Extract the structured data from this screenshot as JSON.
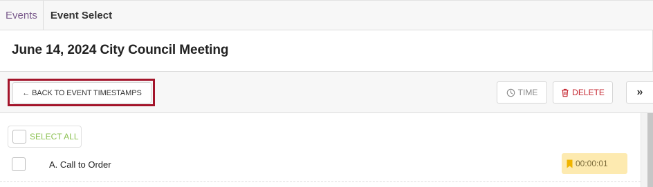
{
  "breadcrumb": {
    "parent": "Events",
    "current": "Event Select"
  },
  "page": {
    "title": "June 14, 2024 City Council Meeting"
  },
  "toolbar": {
    "back_label": "← BACK TO EVENT TIMESTAMPS",
    "time_label": "TIME",
    "time_icon": "clock-icon",
    "delete_label": "DELETE",
    "delete_icon": "trash-icon",
    "more_label": "»"
  },
  "list": {
    "select_all_label": "SELECT ALL",
    "items": [
      {
        "label": "A. Call to Order",
        "timestamp": "00:00:01",
        "icon": "bookmark-icon"
      }
    ]
  },
  "colors": {
    "breadcrumb_link": "#7a5a8c",
    "highlight_border": "#a3142a",
    "delete": "#c4232d",
    "select_all": "#8cc152",
    "timestamp_bg": "#fdeab0",
    "bookmark": "#f0b400"
  }
}
